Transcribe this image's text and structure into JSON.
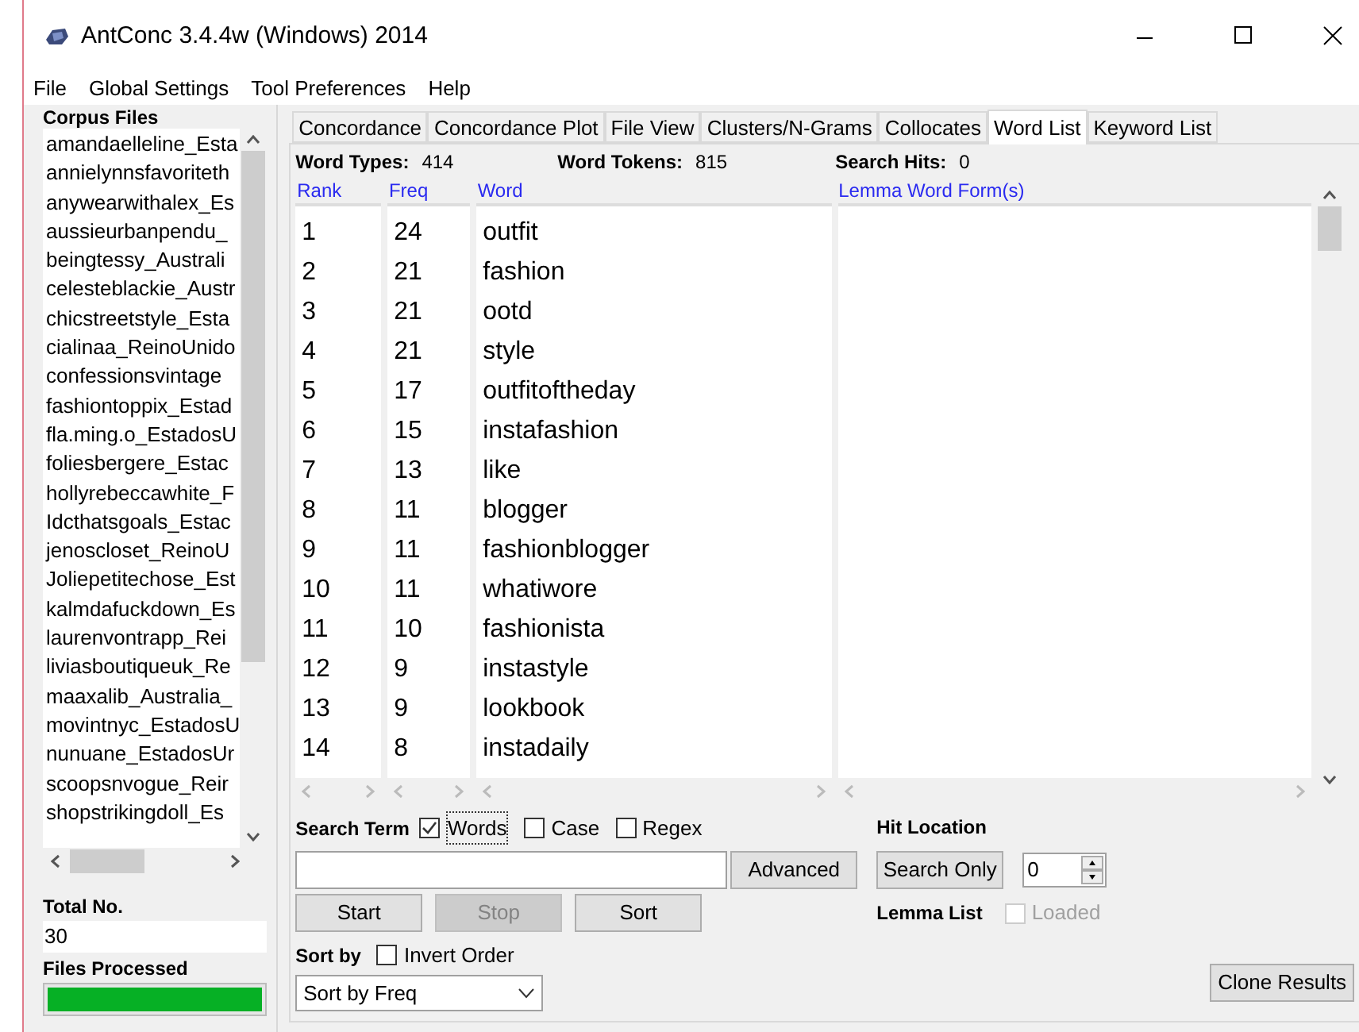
{
  "window": {
    "title": "AntConc 3.4.4w (Windows) 2014"
  },
  "menu": [
    "File",
    "Global Settings",
    "Tool Preferences",
    "Help"
  ],
  "corpus_files": {
    "label": "Corpus Files",
    "files": [
      "amandaelleline_Esta",
      "annielynnsfavoriteth",
      "anywearwithalex_Es",
      "aussieurbanpendu_",
      "beingtessy_Australi",
      "celesteblackie_Austr",
      "chicstreetstyle_Esta",
      "cialinaa_ReinoUnido",
      "confessionsvintage",
      "fashiontoppix_Estad",
      "fla.ming.o_EstadosU",
      "foliesbergere_Estac",
      "hollyrebeccawhite_F",
      "Idcthatsgoals_Estac",
      "jenoscloset_ReinoU",
      "Joliepetitechose_Est",
      "kalmdafuckdown_Es",
      "laurenvontrapp_Rei",
      "liviasboutiqueuk_Re",
      "maaxalib_Australia_",
      "movintnyc_EstadosU",
      "nunuane_EstadosUr",
      "scoopsnvogue_Reir",
      "shopstrikingdoll_Es"
    ]
  },
  "total_no": {
    "label": "Total No.",
    "value": "30"
  },
  "files_processed": {
    "label": "Files Processed",
    "level": 1
  },
  "tabs": [
    {
      "label": "Concordance",
      "selected": false
    },
    {
      "label": "Concordance Plot",
      "selected": false
    },
    {
      "label": "File View",
      "selected": false
    },
    {
      "label": "Clusters/N-Grams",
      "selected": false
    },
    {
      "label": "Collocates",
      "selected": false
    },
    {
      "label": "Word List",
      "selected": true
    },
    {
      "label": "Keyword List",
      "selected": false
    }
  ],
  "stats": [
    {
      "label": "Word Types:",
      "value": "414"
    },
    {
      "label": "Word Tokens:",
      "value": "815"
    },
    {
      "label": "Search Hits:",
      "value": "0"
    }
  ],
  "columns": [
    "Rank",
    "Freq",
    "Word",
    "Lemma Word Form(s)"
  ],
  "rows": [
    {
      "rank": "1",
      "freq": "24",
      "word": "outfit"
    },
    {
      "rank": "2",
      "freq": "21",
      "word": "fashion"
    },
    {
      "rank": "3",
      "freq": "21",
      "word": "ootd"
    },
    {
      "rank": "4",
      "freq": "21",
      "word": "style"
    },
    {
      "rank": "5",
      "freq": "17",
      "word": "outfitoftheday"
    },
    {
      "rank": "6",
      "freq": "15",
      "word": "instafashion"
    },
    {
      "rank": "7",
      "freq": "13",
      "word": "like"
    },
    {
      "rank": "8",
      "freq": "11",
      "word": "blogger"
    },
    {
      "rank": "9",
      "freq": "11",
      "word": "fashionblogger"
    },
    {
      "rank": "10",
      "freq": "11",
      "word": "whatiwore"
    },
    {
      "rank": "11",
      "freq": "10",
      "word": "fashionista"
    },
    {
      "rank": "12",
      "freq": "9",
      "word": "instastyle"
    },
    {
      "rank": "13",
      "freq": "9",
      "word": "lookbook"
    },
    {
      "rank": "14",
      "freq": "8",
      "word": "instadaily"
    }
  ],
  "search": {
    "label": "Search Term",
    "options": [
      {
        "label": "Words",
        "checked": true
      },
      {
        "label": "Case",
        "checked": false
      },
      {
        "label": "Regex",
        "checked": false
      }
    ],
    "advanced": "Advanced"
  },
  "buttons": [
    {
      "label": "Start",
      "disabled": false
    },
    {
      "label": "Stop",
      "disabled": true
    },
    {
      "label": "Sort",
      "disabled": false
    }
  ],
  "sort": {
    "label": "Sort by",
    "invert": {
      "label": "Invert Order",
      "checked": false
    },
    "value": "Sort by Freq"
  },
  "hit_location": {
    "label": "Hit Location",
    "button": "Search Only",
    "value": "0"
  },
  "lemma_list": {
    "label": "Lemma List",
    "loaded": {
      "label": "Loaded",
      "checked": false,
      "disabled": true
    }
  },
  "clone": "Clone Results"
}
